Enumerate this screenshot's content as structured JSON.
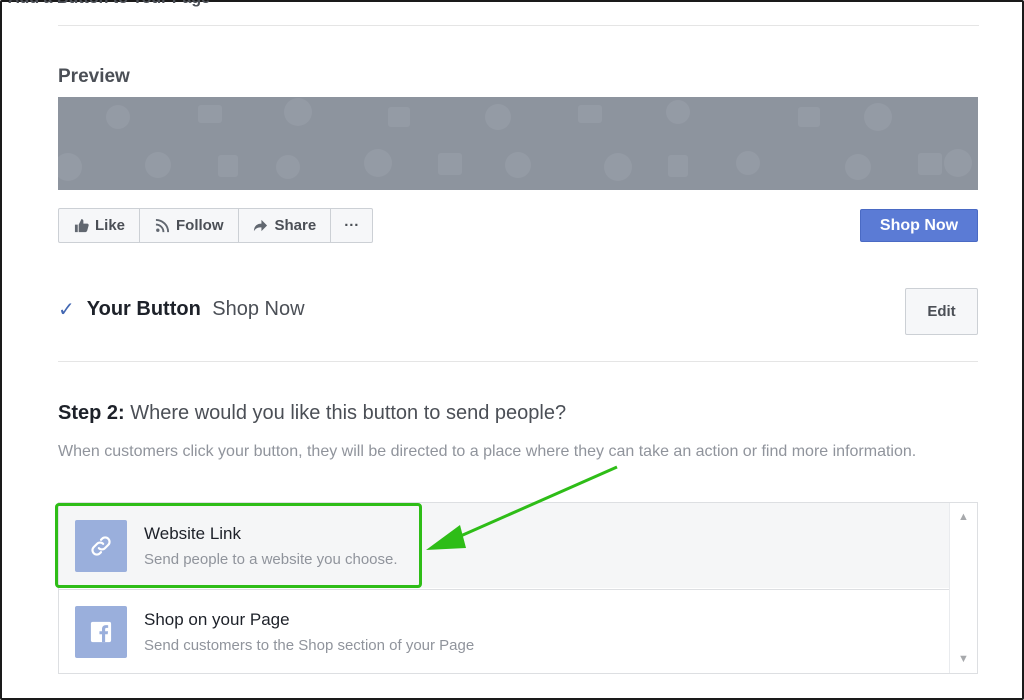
{
  "header": {
    "title": "Add a Button to Your Page"
  },
  "preview": {
    "label": "Preview",
    "actions": [
      {
        "label": "Like",
        "icon": "thumbs-up-icon"
      },
      {
        "label": "Follow",
        "icon": "rss-icon"
      },
      {
        "label": "Share",
        "icon": "share-icon"
      },
      {
        "label": "···",
        "icon": "more-icon"
      }
    ],
    "cta_label": "Shop Now"
  },
  "your_button": {
    "title": "Your Button",
    "value": "Shop Now",
    "edit_label": "Edit"
  },
  "step": {
    "prefix": "Step 2:",
    "question": "Where would you like this button to send people?",
    "description": "When customers click your button, they will be directed to a place where they can take an action or find more information."
  },
  "options": [
    {
      "title": "Website Link",
      "subtitle": "Send people to a website you choose.",
      "icon": "link-icon",
      "selected": true
    },
    {
      "title": "Shop on your Page",
      "subtitle": "Send customers to the Shop section of your Page",
      "icon": "facebook-icon",
      "selected": false
    }
  ],
  "colors": {
    "accent": "#5b7bd5",
    "highlight": "#2ebd17",
    "cover": "#8d949e"
  }
}
